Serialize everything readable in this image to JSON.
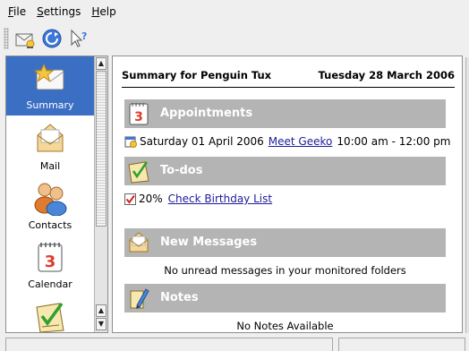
{
  "menubar": {
    "items": [
      {
        "mnemonic": "F",
        "rest": "ile"
      },
      {
        "mnemonic": "S",
        "rest": "ettings"
      },
      {
        "mnemonic": "H",
        "rest": "elp"
      }
    ]
  },
  "toolbar": {
    "buttons": [
      {
        "icon": "new-mail-icon"
      },
      {
        "icon": "sync-icon"
      },
      {
        "icon": "whats-this-icon"
      }
    ]
  },
  "sidebar": {
    "items": [
      {
        "label": "Summary",
        "icon": "summary-icon",
        "active": true
      },
      {
        "label": "Mail",
        "icon": "mail-icon"
      },
      {
        "label": "Contacts",
        "icon": "contacts-icon"
      },
      {
        "label": "Calendar",
        "icon": "calendar-icon"
      },
      {
        "label": "",
        "icon": "todo-icon"
      }
    ]
  },
  "summary": {
    "title": "Summary for Penguin Tux",
    "date": "Tuesday 28 March 2006",
    "appointments": {
      "heading": "Appointments",
      "item": {
        "date": "Saturday 01 April 2006",
        "title": "Meet Geeko",
        "time": "10:00 am - 12:00 pm"
      }
    },
    "todos": {
      "heading": "To-dos",
      "item": {
        "percent": "20%",
        "title": "Check Birthday List"
      }
    },
    "messages": {
      "heading": "New Messages",
      "empty": "No unread messages in your monitored folders"
    },
    "notes": {
      "heading": "Notes",
      "empty": "No Notes Available"
    }
  },
  "colors": {
    "selection": "#3b6fc4",
    "section_bar": "#b4b4b4",
    "link": "#1d1d9a"
  }
}
